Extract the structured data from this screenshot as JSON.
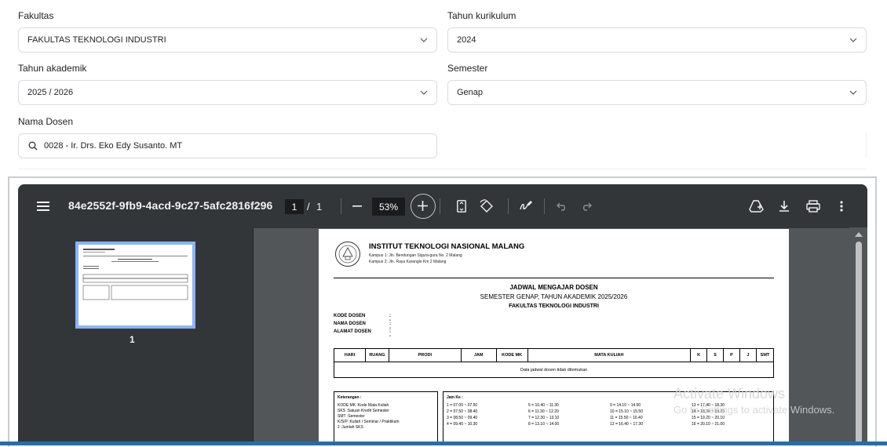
{
  "form": {
    "fakultas": {
      "label": "Fakultas",
      "value": "FAKULTAS TEKNOLOGI INDUSTRI"
    },
    "tahun_kurikulum": {
      "label": "Tahun kurikulum",
      "value": "2024"
    },
    "tahun_akademik": {
      "label": "Tahun akademik",
      "value": "2025 / 2026"
    },
    "semester": {
      "label": "Semester",
      "value": "Genap"
    },
    "nama_dosen": {
      "label": "Nama Dosen",
      "value": "0028 - Ir. Drs. Eko Edy Susanto. MT"
    }
  },
  "viewer": {
    "title": "84e2552f-9fb9-4acd-9c27-5afc2816f296",
    "page_current": "1",
    "page_sep": "/",
    "page_total": "1",
    "zoom": "53%",
    "thumb_label": "1"
  },
  "document": {
    "institution": "INSTITUT TEKNOLOGI NASIONAL MALANG",
    "campus1": "Kampus 1: Jln. Bendungan Sigura-gura No. 2 Malang",
    "campus2": "Kampus 2: Jln. Raya Karanglo Km 2 Malang",
    "heading": "JADWAL MENGAJAR DOSEN",
    "subheading": "SEMESTER GENAP, TAHUN AKADEMIK 2025/2026",
    "faculty": "FAKULTAS TEKNOLOGI INDUSTRI",
    "fields": [
      {
        "key": "KODE DOSEN",
        "value": ": -"
      },
      {
        "key": "NAMA DOSEN",
        "value": ": -"
      },
      {
        "key": "ALAMAT DOSEN",
        "value": ": -"
      }
    ],
    "columns": [
      "HARI",
      "RUANG",
      "PRODI",
      "JAM",
      "KODE MK",
      "MATA KULIAH",
      "K",
      "S",
      "P",
      "J",
      "SMT"
    ],
    "empty_message": "Data jadwal dosen tidak ditemukan",
    "keterangan_title": "Keterangan :",
    "keterangan": [
      "KODE MK :Kode Mata Kuliah",
      "SKS :Satuan Kredit Semester",
      "SMT :Semester",
      "K/S/P :Kuliah / Seminar / Praktikum",
      "J :Jumlah SKS"
    ],
    "jam_title": "Jam Ke :",
    "jam": [
      "1 = 07.00 ~ 07.50",
      "5 = 10.40 ~ 11.30",
      "9 = 14.10 ~ 14.50",
      "13 = 17.40 ~ 18.30",
      "2 = 07.50 ~ 08.40",
      "6 = 11.30 ~ 12.20",
      "10 = 15.10 ~ 15.50",
      "14 = 18.30 ~ 19.20",
      "3 = 08.50 ~ 09.40",
      "7 = 12.30 ~ 13.10",
      "11 = 15.50 ~ 16.40",
      "15 = 19.20 ~ 20.10",
      "4 = 09.40 ~ 10.30",
      "8 = 13.10 ~ 14.00",
      "12 = 16.40 ~ 17.30",
      "16 = 20.10 ~ 21.00"
    ]
  },
  "watermark": {
    "line1": "Activate Windows",
    "line2": "Go to Settings to activate Windows."
  },
  "icons": [
    "menu-icon",
    "minus-icon",
    "plus-icon",
    "fit-page-icon",
    "rotate-icon",
    "annotate-icon",
    "undo-icon",
    "redo-icon",
    "drive-add-icon",
    "download-icon",
    "print-icon",
    "more-vert-icon",
    "search-icon",
    "chevron-down-icon"
  ]
}
